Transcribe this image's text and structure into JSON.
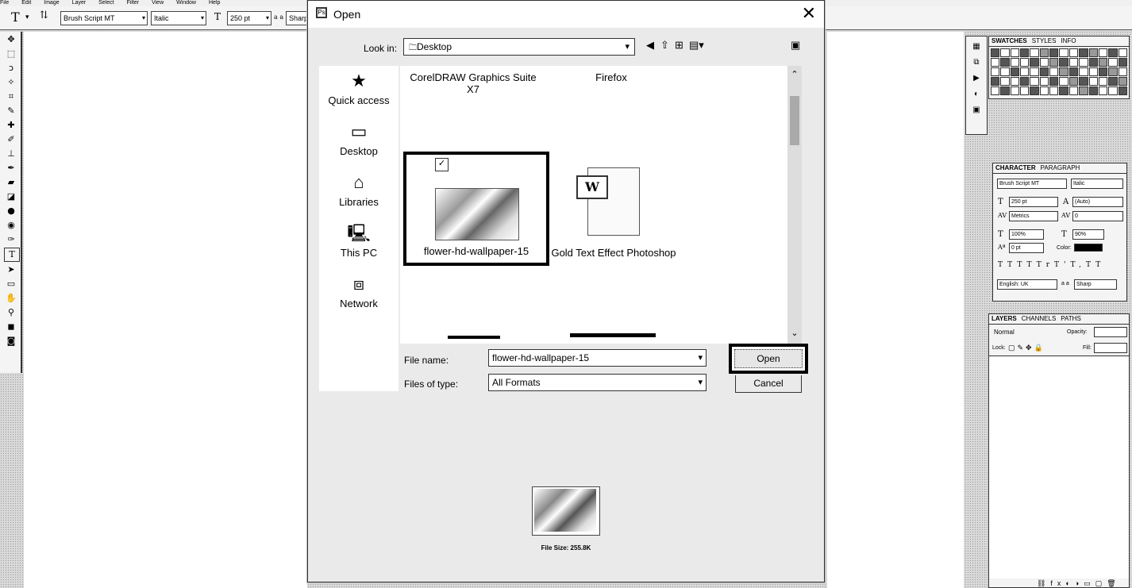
{
  "app": {
    "menus": [
      "File",
      "Edit",
      "Image",
      "Layer",
      "Select",
      "Filter",
      "View",
      "Window",
      "Help"
    ],
    "options_bar": {
      "font_family": "Brush Script MT",
      "font_style": "Italic",
      "font_size": "250 pt",
      "antialias": "Sharp",
      "aa_label": "a a"
    }
  },
  "toolbox": {
    "tools": [
      "move",
      "marquee",
      "lasso",
      "quick-select",
      "crop",
      "eyedropper",
      "healing",
      "brush",
      "stamp",
      "history-brush",
      "eraser",
      "gradient",
      "blur",
      "dodge",
      "pen",
      "type",
      "path-select",
      "shape",
      "hand",
      "zoom",
      "colors",
      "quick-mask"
    ]
  },
  "panels": {
    "swatches_tabs": [
      "SWATCHES",
      "STYLES",
      "INFO"
    ],
    "character_tabs": [
      "CHARACTER",
      "PARAGRAPH"
    ],
    "character": {
      "font_family": "Brush Script MT",
      "font_style": "Italic",
      "font_size": "250 pt",
      "leading": "(Auto)",
      "kerning": "Metrics",
      "tracking": "0",
      "vert_scale": "100%",
      "horiz_scale": "90%",
      "baseline": "0 pt",
      "color_label": "Color:",
      "language": "English: UK",
      "antialias": "Sharp",
      "aa_label": "a a",
      "style_buttons": [
        "T",
        "T",
        "TT",
        "Tr",
        "T'",
        "T,",
        "T",
        "T"
      ]
    },
    "layers_tabs": [
      "LAYERS",
      "CHANNELS",
      "PATHS"
    ],
    "layers": {
      "blend_mode": "Normal",
      "opacity_label": "Opacity:",
      "lock_label": "Lock:",
      "fill_label": "Fill:"
    }
  },
  "dialog": {
    "title": "Open",
    "look_in_label": "Look in:",
    "look_in_value": "Desktop",
    "places": [
      {
        "label": "Quick access",
        "icon": "star-icon"
      },
      {
        "label": "Desktop",
        "icon": "desktop-icon"
      },
      {
        "label": "Libraries",
        "icon": "libraries-icon"
      },
      {
        "label": "This PC",
        "icon": "computer-icon"
      },
      {
        "label": "Network",
        "icon": "network-icon"
      }
    ],
    "files": {
      "corel_line1": "CorelDRAW Graphics Suite",
      "corel_line2": "X7",
      "firefox": "Firefox",
      "selected": "flower-hd-wallpaper-15",
      "word_doc": "Gold Text Effect Photoshop"
    },
    "file_name_label": "File name:",
    "file_name_value": "flower-hd-wallpaper-15",
    "files_of_type_label": "Files of type:",
    "files_of_type_value": "All Formats",
    "open_label": "Open",
    "cancel_label": "Cancel",
    "file_size": "File Size: 255.8K"
  }
}
